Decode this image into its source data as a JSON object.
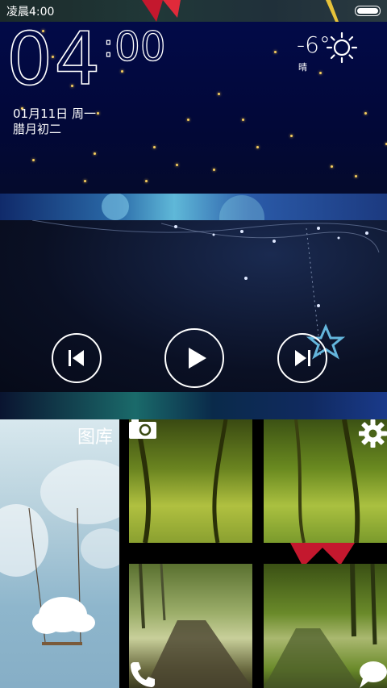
{
  "status_bar": {
    "time": "凌晨4:00"
  },
  "clock": {
    "hour": "04",
    "minute": "00",
    "date": "01月11日  周一",
    "lunar": "腊月初二"
  },
  "weather": {
    "temp": "-6°",
    "condition": "晴",
    "icon": "sun-icon"
  },
  "music": {
    "prev_icon": "skip-previous-icon",
    "play_icon": "play-icon",
    "next_icon": "skip-next-icon"
  },
  "tiles": {
    "gallery_label": "图库",
    "camera_icon": "camera-icon",
    "settings_icon": "gear-icon",
    "phone_icon": "phone-icon",
    "messages_icon": "chat-bubble-icon"
  }
}
